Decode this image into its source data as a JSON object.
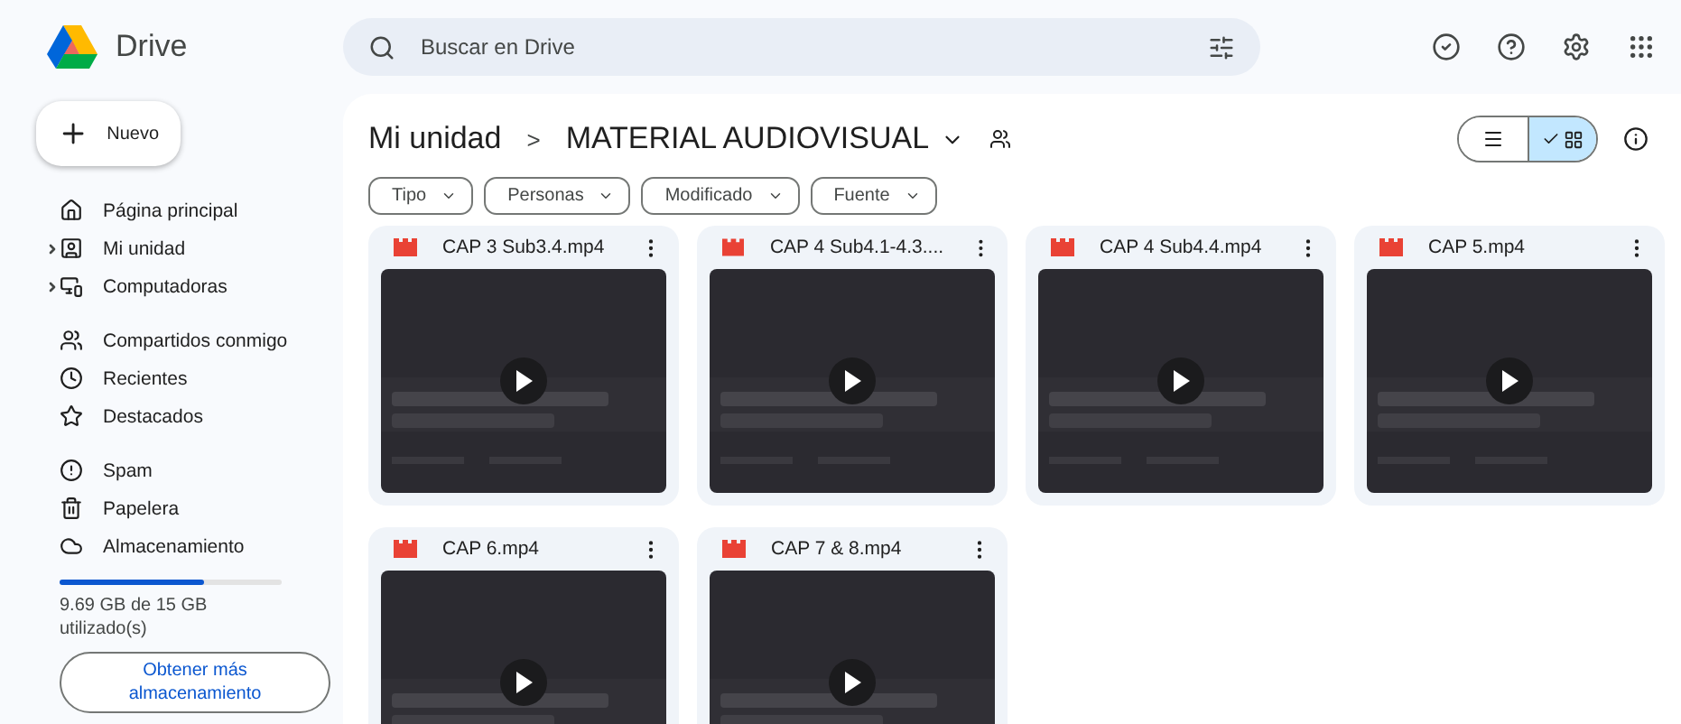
{
  "app": {
    "name": "Drive"
  },
  "search": {
    "placeholder": "Buscar en Drive"
  },
  "new_button": {
    "label": "Nuevo"
  },
  "nav_groups": [
    [
      {
        "label": "Página principal",
        "selected": false,
        "collapsible": false
      },
      {
        "label": "Mi unidad",
        "selected": false,
        "collapsible": true
      },
      {
        "label": "Computadoras",
        "selected": false,
        "collapsible": true
      }
    ],
    [
      {
        "label": "Compartidos conmigo",
        "selected": false,
        "collapsible": false
      },
      {
        "label": "Recientes",
        "selected": false,
        "collapsible": false
      },
      {
        "label": "Destacados",
        "selected": false,
        "collapsible": false
      }
    ],
    [
      {
        "label": "Spam",
        "selected": false,
        "collapsible": false
      },
      {
        "label": "Papelera",
        "selected": false,
        "collapsible": false
      },
      {
        "label": "Almacenamiento",
        "selected": false,
        "collapsible": false
      }
    ]
  ],
  "storage": {
    "level": 0.65,
    "usage": "9.69 GB de 15 GB utilizado(s)",
    "button": "Obtener más almacenamiento"
  },
  "breadcrumb": {
    "root": "Mi unidad",
    "separator": ">",
    "current": "MATERIAL AUDIOVISUAL"
  },
  "view_toggle": [
    {
      "kind": "list",
      "selected": false
    },
    {
      "kind": "grid",
      "selected": true
    }
  ],
  "filters": [
    "Tipo",
    "Personas",
    "Modificado",
    "Fuente"
  ],
  "files": [
    {
      "name": "CAP 3 Sub3.4.mp4"
    },
    {
      "name": "CAP 4 Sub4.1-4.3...."
    },
    {
      "name": "CAP 4 Sub4.4.mp4"
    },
    {
      "name": "CAP 5.mp4"
    },
    {
      "name": "CAP 6.mp4"
    },
    {
      "name": "CAP 7 & 8.mp4"
    }
  ]
}
